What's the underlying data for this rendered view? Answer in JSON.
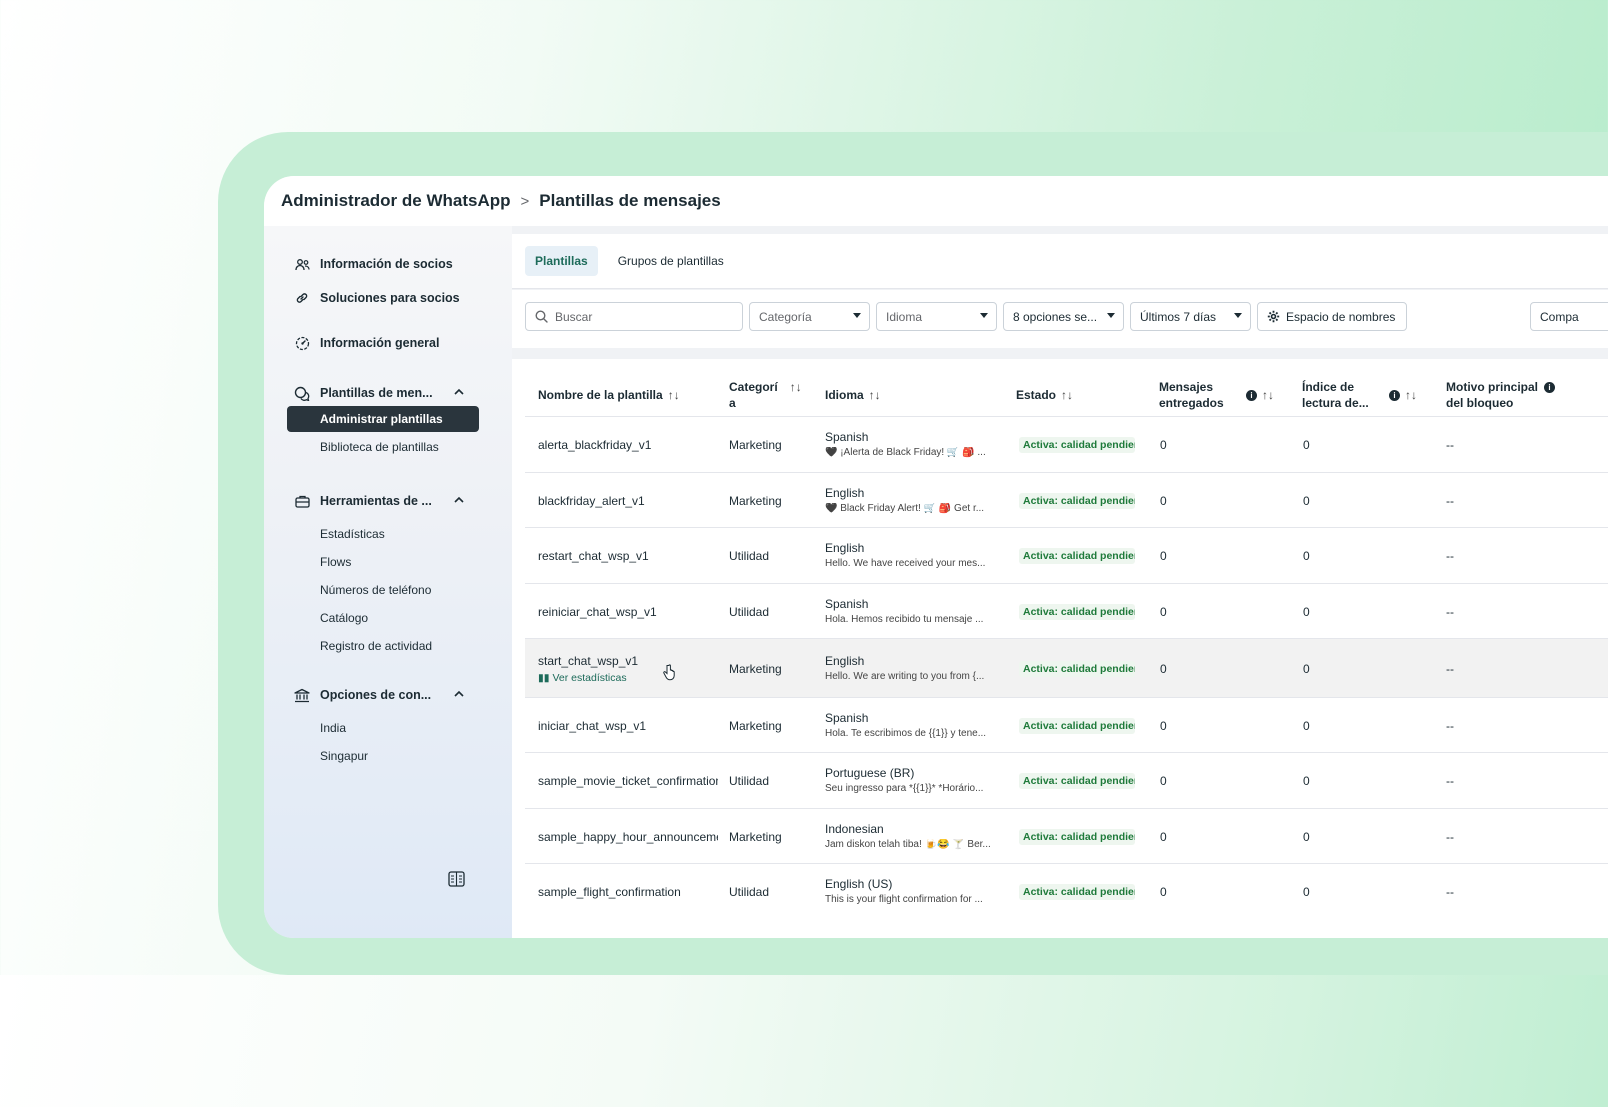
{
  "breadcrumb": {
    "root": "Administrador de WhatsApp",
    "separator": ">",
    "current": "Plantillas de mensajes"
  },
  "sidebar": {
    "items": [
      {
        "label": "Información de socios",
        "icon": "people-icon"
      },
      {
        "label": "Soluciones para socios",
        "icon": "link-icon"
      },
      {
        "label": "Información general",
        "icon": "gauge-icon"
      },
      {
        "label": "Plantillas de men...",
        "icon": "chat-bubbles-icon",
        "expanded": true,
        "children": [
          {
            "label": "Administrar plantillas",
            "active": true
          },
          {
            "label": "Biblioteca de plantillas"
          }
        ]
      },
      {
        "label": "Herramientas de ...",
        "icon": "briefcase-icon",
        "expanded": true,
        "children": [
          {
            "label": "Estadísticas"
          },
          {
            "label": "Flows"
          },
          {
            "label": "Números de teléfono"
          },
          {
            "label": "Catálogo"
          },
          {
            "label": "Registro de actividad"
          }
        ]
      },
      {
        "label": "Opciones de con...",
        "icon": "bank-icon",
        "expanded": true,
        "children": [
          {
            "label": "India"
          },
          {
            "label": "Singapur"
          }
        ]
      }
    ]
  },
  "tabs": [
    {
      "label": "Plantillas",
      "active": true
    },
    {
      "label": "Grupos de plantillas",
      "active": false
    }
  ],
  "filters": {
    "search_placeholder": "Buscar",
    "category": "Categoría",
    "language": "Idioma",
    "status": "8 opciones se...",
    "date": "Últimos 7 días",
    "namespace": "Espacio de nombres",
    "compare": "Compa"
  },
  "table": {
    "headers": {
      "name": "Nombre de la plantilla",
      "category_l1": "Categorí",
      "category_l2": "a",
      "language": "Idioma",
      "status": "Estado",
      "delivered_l1": "Mensajes",
      "delivered_l2": "entregados",
      "read_l1": "Índice de",
      "read_l2": "lectura de...",
      "block_l1": "Motivo principal",
      "block_l2": "del bloqueo",
      "sort": "↑↓"
    },
    "rows": [
      {
        "name": "alerta_blackfriday_v1",
        "category": "Marketing",
        "language": "Spanish",
        "preview": "🖤 ¡Alerta de Black Friday! 🛒 🎒 ...",
        "status": "Activa: calidad pendiente",
        "delivered": "0",
        "read": "0",
        "block": "--"
      },
      {
        "name": "blackfriday_alert_v1",
        "category": "Marketing",
        "language": "English",
        "preview": "🖤 Black Friday Alert! 🛒 🎒 Get r...",
        "status": "Activa: calidad pendiente",
        "delivered": "0",
        "read": "0",
        "block": "--"
      },
      {
        "name": "restart_chat_wsp_v1",
        "category": "Utilidad",
        "language": "English",
        "preview": "Hello. We have received your mes...",
        "status": "Activa: calidad pendiente",
        "delivered": "0",
        "read": "0",
        "block": "--"
      },
      {
        "name": "reiniciar_chat_wsp_v1",
        "category": "Utilidad",
        "language": "Spanish",
        "preview": "Hola. Hemos recibido tu mensaje ...",
        "status": "Activa: calidad pendiente",
        "delivered": "0",
        "read": "0",
        "block": "--"
      },
      {
        "name": "start_chat_wsp_v1",
        "stats_link": "Ver estadísticas",
        "category": "Marketing",
        "language": "English",
        "preview": "Hello. We are writing to you from {...",
        "status": "Activa: calidad pendiente",
        "delivered": "0",
        "read": "0",
        "block": "--"
      },
      {
        "name": "iniciar_chat_wsp_v1",
        "category": "Marketing",
        "language": "Spanish",
        "preview": "Hola. Te escribimos de {{1}} y tene...",
        "status": "Activa: calidad pendiente",
        "delivered": "0",
        "read": "0",
        "block": "--"
      },
      {
        "name": "sample_movie_ticket_confirmation",
        "category": "Utilidad",
        "language": "Portuguese (BR)",
        "preview": "Seu ingresso para *{{1}}* *Horário...",
        "status": "Activa: calidad pendiente",
        "delivered": "0",
        "read": "0",
        "block": "--"
      },
      {
        "name": "sample_happy_hour_announcement",
        "category": "Marketing",
        "language": "Indonesian",
        "preview": "Jam diskon telah tiba! 🍺😂 🍸 Ber...",
        "status": "Activa: calidad pendiente",
        "delivered": "0",
        "read": "0",
        "block": "--"
      },
      {
        "name": "sample_flight_confirmation",
        "category": "Utilidad",
        "language": "English (US)",
        "preview": "This is your flight confirmation for ...",
        "status": "Activa: calidad pendiente",
        "delivered": "0",
        "read": "0",
        "block": "--"
      }
    ]
  }
}
